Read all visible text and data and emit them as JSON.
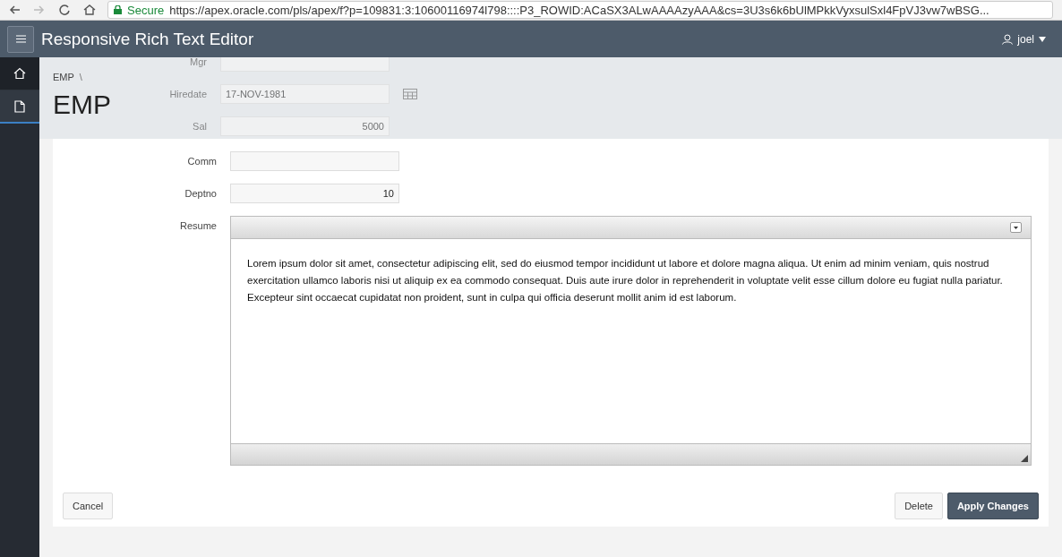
{
  "browser": {
    "secure_label": "Secure",
    "url": "https://apex.oracle.com/pls/apex/f?p=109831:3:10600116974l798::::P3_ROWID:ACaSX3ALwAAAAzyAAA&cs=3U3s6k6bUlMPkkVyxsulSxl4FpVJ3vw7wBSG..."
  },
  "header": {
    "title": "Responsive Rich Text Editor",
    "user": "joel"
  },
  "sidebar": {
    "items": [
      {
        "kind": "home",
        "selected": false
      },
      {
        "kind": "page",
        "selected": true
      }
    ]
  },
  "breadcrumb": "EMP",
  "breadcrumb_separator": "\\",
  "page_title": "EMP",
  "scrolled_fields": [
    {
      "label": "Mgr",
      "kind": "text"
    },
    {
      "label": "Hiredate",
      "value": "17-NOV-1981",
      "kind": "date"
    },
    {
      "label": "Sal",
      "value": "5000",
      "kind": "number"
    }
  ],
  "fields": [
    {
      "label": "Comm"
    },
    {
      "label": "Deptno",
      "value": "10"
    }
  ],
  "resume": {
    "label": "Resume",
    "text": "Lorem ipsum dolor sit amet, consectetur adipiscing elit, sed do eiusmod tempor incididunt ut labore et dolore magna aliqua. Ut enim ad minim veniam, quis nostrud exercitation ullamco laboris nisi ut aliquip ex ea commodo consequat. Duis aute irure dolor in reprehenderit in voluptate velit esse cillum dolore eu fugiat nulla pariatur. Excepteur sint occaecat cupidatat non proident, sunt in culpa qui officia deserunt mollit anim id est laborum."
  },
  "buttons": [
    {
      "label": "Cancel",
      "kind": "default"
    },
    {
      "label": "Delete",
      "kind": "default"
    },
    {
      "label": "Apply Changes",
      "kind": "primary"
    }
  ]
}
